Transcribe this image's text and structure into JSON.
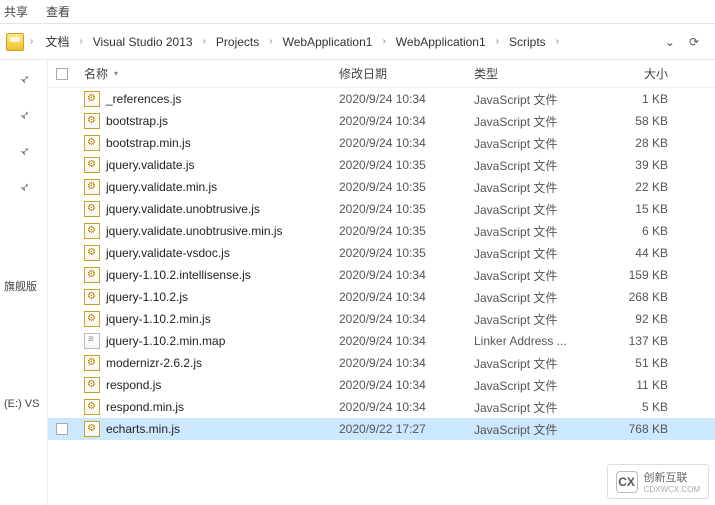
{
  "topbar": {
    "share": "共享",
    "view": "查看"
  },
  "breadcrumbs": [
    "文档",
    "Visual Studio 2013",
    "Projects",
    "WebApplication1",
    "WebApplication1",
    "Scripts"
  ],
  "columns": {
    "name": "名称",
    "date": "修改日期",
    "type": "类型",
    "size": "大小"
  },
  "sidebar": {
    "label1": "旗舰版",
    "label2": "(E:) VS"
  },
  "files": [
    {
      "icon": "js",
      "name": "_references.js",
      "date": "2020/9/24 10:34",
      "type": "JavaScript 文件",
      "size": "1 KB",
      "selected": false
    },
    {
      "icon": "js",
      "name": "bootstrap.js",
      "date": "2020/9/24 10:34",
      "type": "JavaScript 文件",
      "size": "58 KB",
      "selected": false
    },
    {
      "icon": "js",
      "name": "bootstrap.min.js",
      "date": "2020/9/24 10:34",
      "type": "JavaScript 文件",
      "size": "28 KB",
      "selected": false
    },
    {
      "icon": "js",
      "name": "jquery.validate.js",
      "date": "2020/9/24 10:35",
      "type": "JavaScript 文件",
      "size": "39 KB",
      "selected": false
    },
    {
      "icon": "js",
      "name": "jquery.validate.min.js",
      "date": "2020/9/24 10:35",
      "type": "JavaScript 文件",
      "size": "22 KB",
      "selected": false
    },
    {
      "icon": "js",
      "name": "jquery.validate.unobtrusive.js",
      "date": "2020/9/24 10:35",
      "type": "JavaScript 文件",
      "size": "15 KB",
      "selected": false
    },
    {
      "icon": "js",
      "name": "jquery.validate.unobtrusive.min.js",
      "date": "2020/9/24 10:35",
      "type": "JavaScript 文件",
      "size": "6 KB",
      "selected": false
    },
    {
      "icon": "js",
      "name": "jquery.validate-vsdoc.js",
      "date": "2020/9/24 10:35",
      "type": "JavaScript 文件",
      "size": "44 KB",
      "selected": false
    },
    {
      "icon": "js",
      "name": "jquery-1.10.2.intellisense.js",
      "date": "2020/9/24 10:34",
      "type": "JavaScript 文件",
      "size": "159 KB",
      "selected": false
    },
    {
      "icon": "js",
      "name": "jquery-1.10.2.js",
      "date": "2020/9/24 10:34",
      "type": "JavaScript 文件",
      "size": "268 KB",
      "selected": false
    },
    {
      "icon": "js",
      "name": "jquery-1.10.2.min.js",
      "date": "2020/9/24 10:34",
      "type": "JavaScript 文件",
      "size": "92 KB",
      "selected": false
    },
    {
      "icon": "map",
      "name": "jquery-1.10.2.min.map",
      "date": "2020/9/24 10:34",
      "type": "Linker Address ...",
      "size": "137 KB",
      "selected": false
    },
    {
      "icon": "js",
      "name": "modernizr-2.6.2.js",
      "date": "2020/9/24 10:34",
      "type": "JavaScript 文件",
      "size": "51 KB",
      "selected": false
    },
    {
      "icon": "js",
      "name": "respond.js",
      "date": "2020/9/24 10:34",
      "type": "JavaScript 文件",
      "size": "11 KB",
      "selected": false
    },
    {
      "icon": "js",
      "name": "respond.min.js",
      "date": "2020/9/24 10:34",
      "type": "JavaScript 文件",
      "size": "5 KB",
      "selected": false
    },
    {
      "icon": "js",
      "name": "echarts.min.js",
      "date": "2020/9/22 17:27",
      "type": "JavaScript 文件",
      "size": "768 KB",
      "selected": true
    }
  ],
  "watermark": {
    "logo": "CX",
    "line1": "创新互联",
    "line2": "CDXWCX.COM"
  }
}
